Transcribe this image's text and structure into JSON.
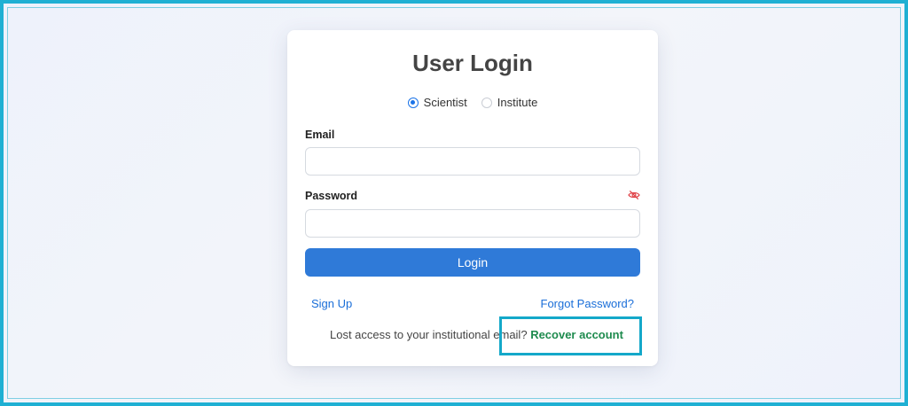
{
  "login": {
    "title": "User Login",
    "roles": [
      {
        "label": "Scientist",
        "selected": true
      },
      {
        "label": "Institute",
        "selected": false
      }
    ],
    "email_label": "Email",
    "email_value": "",
    "password_label": "Password",
    "password_value": "",
    "login_button": "Login",
    "sign_up": "Sign Up",
    "forgot_password": "Forgot Password?",
    "lost_access_text": "Lost access to your institutional email?",
    "recover_account": "Recover account"
  },
  "icons": {
    "password_toggle": "eye-slash-icon"
  },
  "colors": {
    "accent": "#2f7ad8",
    "link": "#1a6ed8",
    "recover": "#1e8b4e",
    "highlight": "#14a8c9",
    "eye_icon": "#e0454a"
  }
}
